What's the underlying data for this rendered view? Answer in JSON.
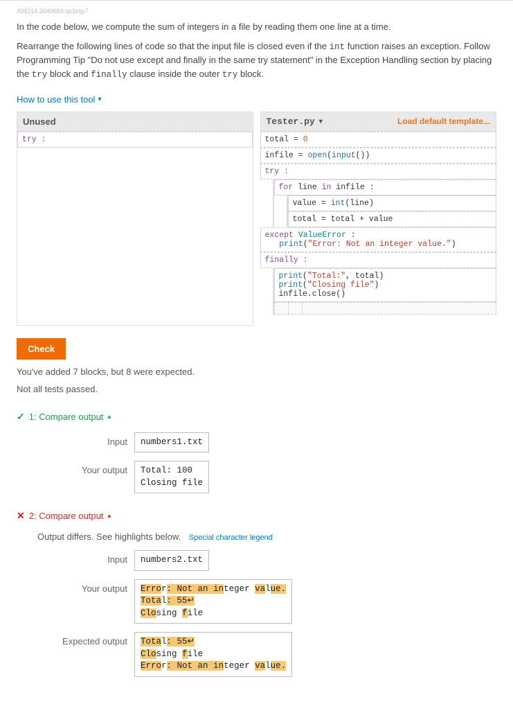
{
  "small_id": "494314.3640684.qx3zqy7",
  "intro_p1_before": "In the code below, we compute the sum of integers in a file by reading them one line at a time.",
  "intro_p2_a": "Rearrange the following lines of code so that the input file is closed even if the ",
  "intro_p2_b": " function raises an exception. Follow Programming Tip \"Do not use except and finally in the same try statement\" in the Exception Handling section by placing the ",
  "intro_p2_c": " block and ",
  "intro_p2_d": " clause inside the outer ",
  "intro_p2_e": " block.",
  "kw_int": "int",
  "kw_try": "try",
  "kw_finally": "finally",
  "tool_link": "How to use this tool",
  "unused_header": "Unused",
  "unused_block": "try :",
  "tester_filename": "Tester.py",
  "load_template": "Load default template...",
  "code": {
    "l1": "total = 0",
    "l2": "infile = open(input())",
    "l3": "try :",
    "l4": "for line in infile :",
    "l5": "value = int(line)",
    "l6": "total = total + value",
    "l7": "except ValueError :",
    "l7b": "   print(\"Error: Not an integer value.\")",
    "l8": "finally :",
    "l9a": "print(\"Total:\", total)",
    "l9b": "print(\"Closing file\")",
    "l9c": "infile.close()"
  },
  "check_label": "Check",
  "feedback1": "You've added 7 blocks, but 8 were expected.",
  "feedback2": "Not all tests passed.",
  "tests": [
    {
      "status": "pass",
      "title": "1: Compare output",
      "input_label": "Input",
      "input_value": "numbers1.txt",
      "your_output_label": "Your output",
      "your_output_value": "Total: 100\nClosing file"
    },
    {
      "status": "fail",
      "title": "2: Compare output",
      "diff_msg": "Output differs. See highlights below.",
      "legend": "Special character legend",
      "input_label": "Input",
      "input_value": "numbers2.txt",
      "your_output_label": "Your output",
      "expected_output_label": "Expected output"
    }
  ],
  "diff": {
    "your": {
      "l1_a": "Erro",
      "l1_b": "r",
      "l1_c": ": ",
      "l1_d": "Not an in",
      "l1_e": "teger ",
      "l1_f": "va",
      "l1_g": "l",
      "l1_h": "ue",
      "l1_i": ".",
      "l2_a": "Tota",
      "l2_b": "l",
      "l2_c": ": ",
      "l2_d": "55",
      "l2_e": "↵",
      "l3_a": "Clo",
      "l3_b": "s",
      "l3_c": "ing ",
      "l3_d": "f",
      "l3_e": "ile"
    },
    "exp": {
      "l1_a": "Tota",
      "l1_b": "l",
      "l1_c": ": ",
      "l1_d": "55",
      "l1_e": "↵",
      "l2_a": "Clo",
      "l2_b": "s",
      "l2_c": "ing ",
      "l2_d": "f",
      "l2_e": "ile",
      "l3_a": "Erro",
      "l3_b": "r",
      "l3_c": ": ",
      "l3_d": "Not an in",
      "l3_e": "teger ",
      "l3_f": "va",
      "l3_g": "l",
      "l3_h": "ue",
      "l3_i": "."
    }
  }
}
